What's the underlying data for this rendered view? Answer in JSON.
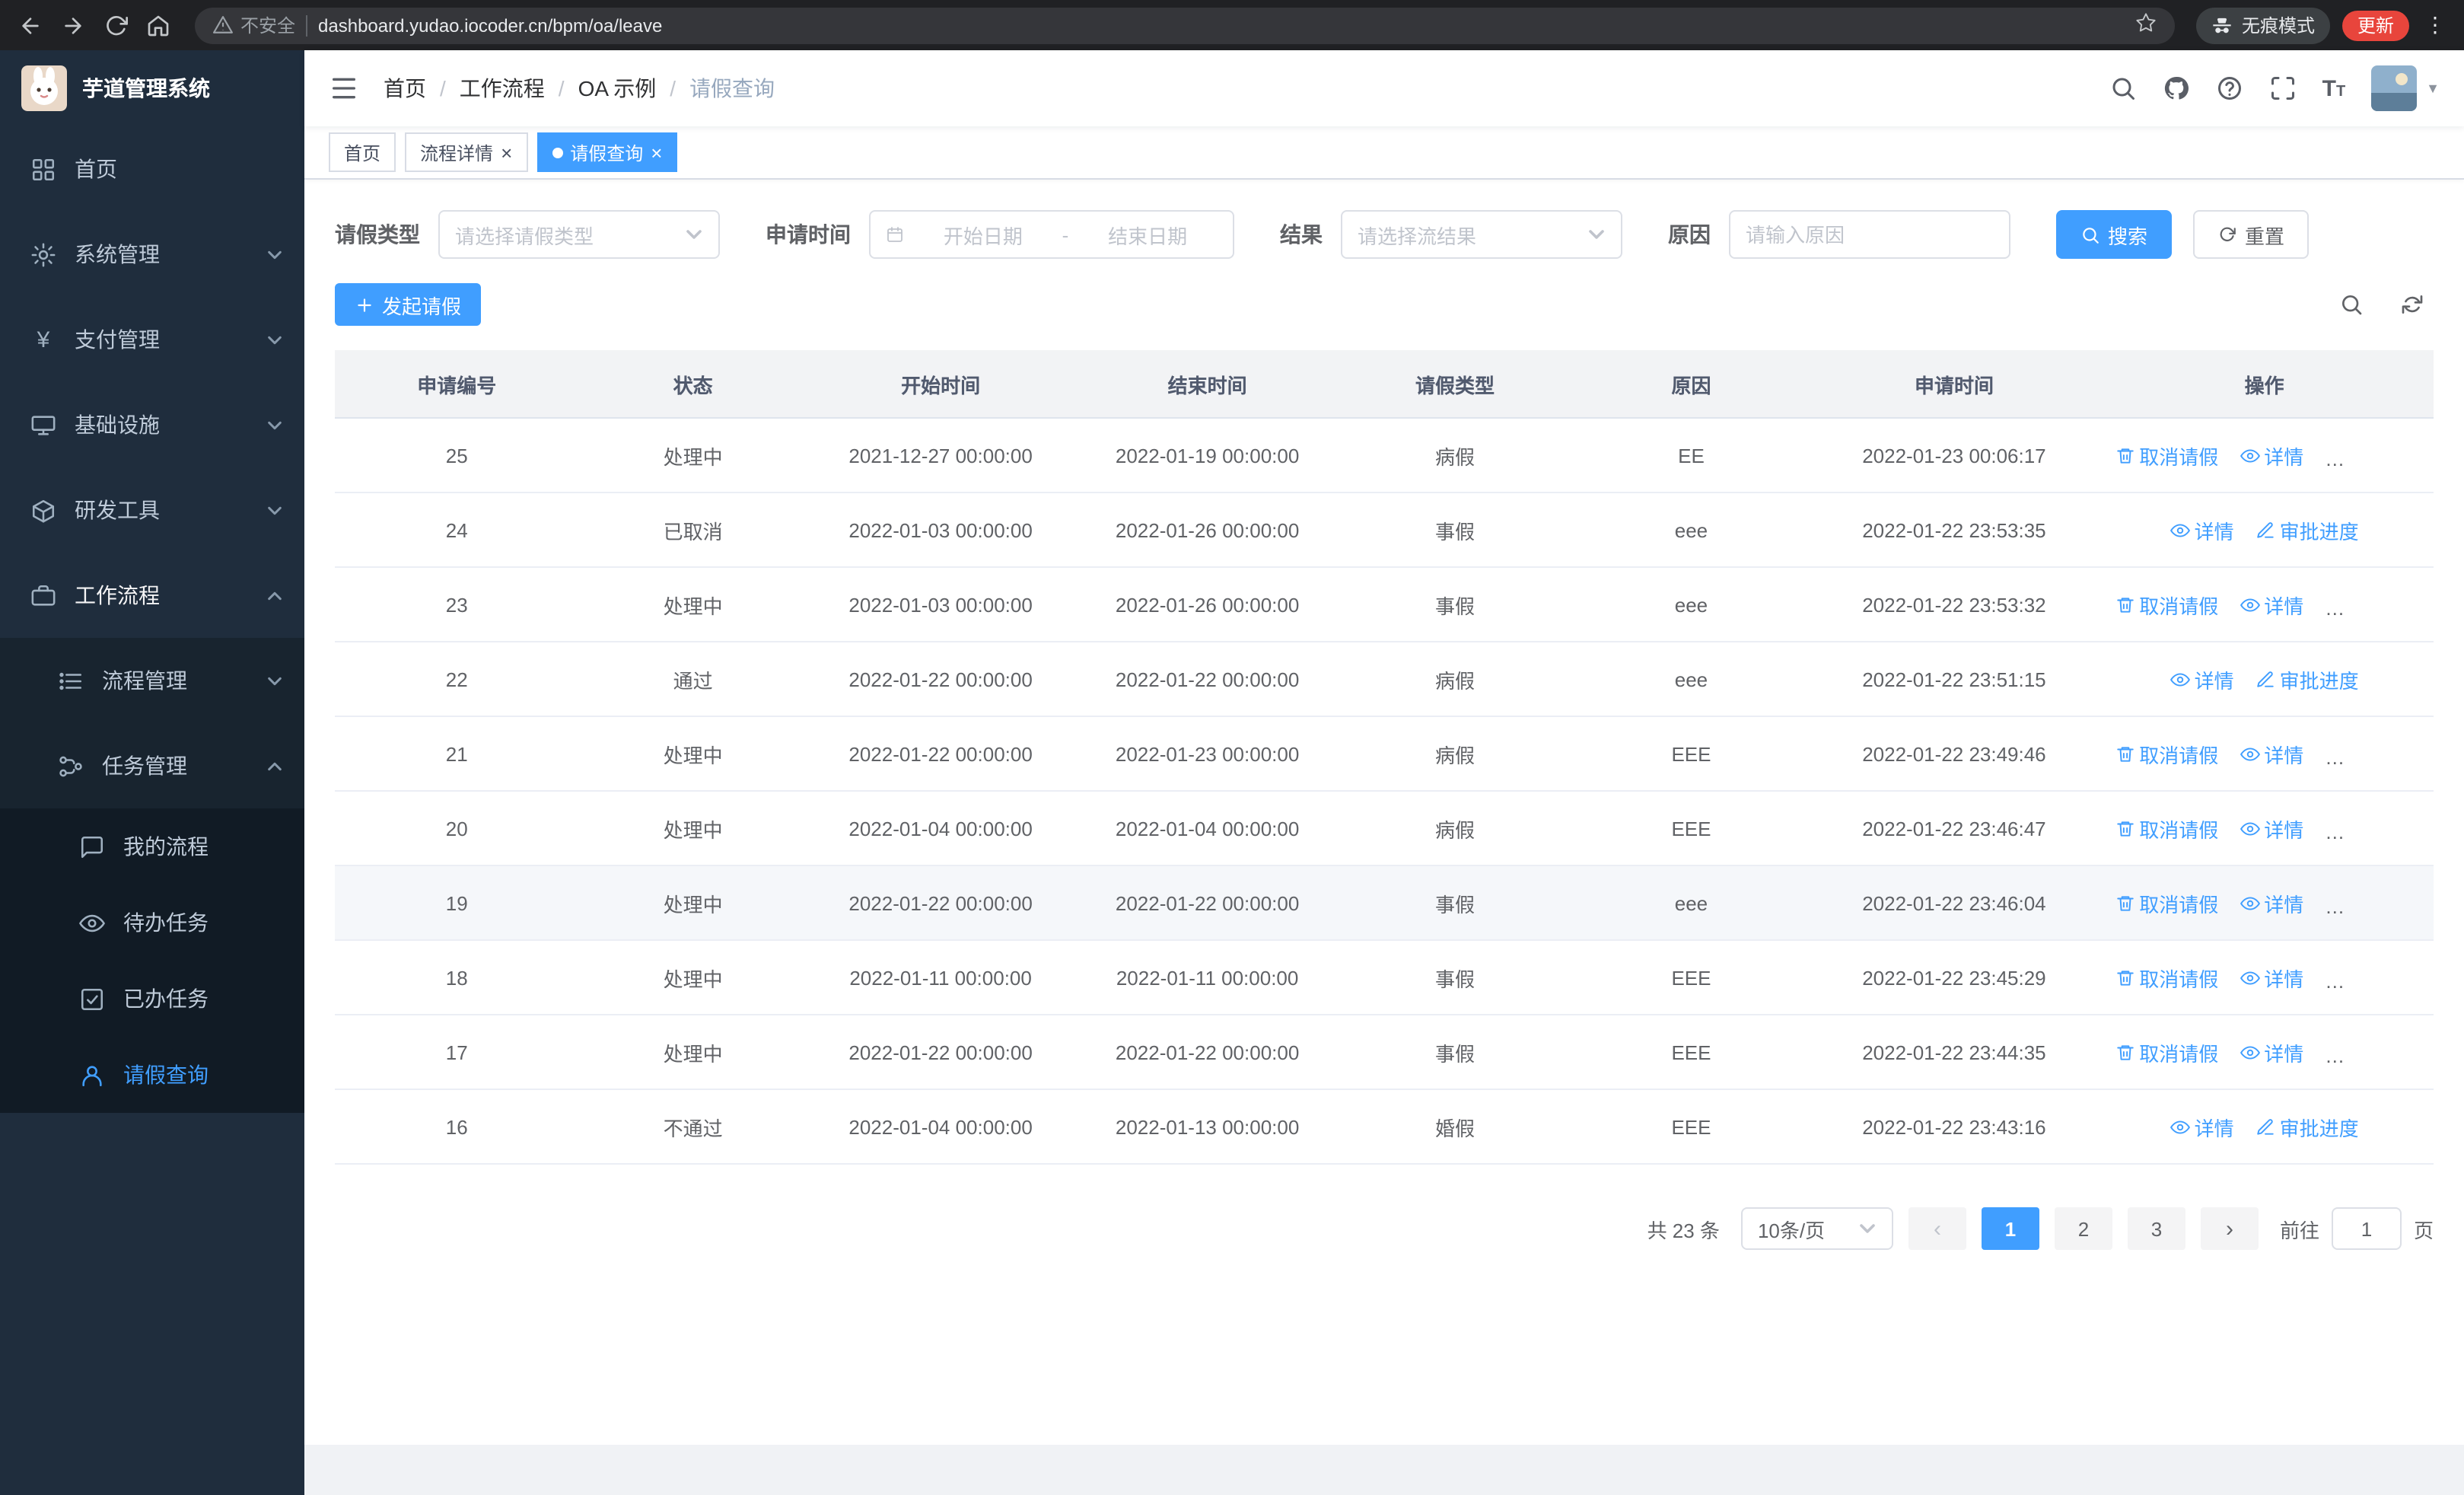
{
  "browser": {
    "security_label": "不安全",
    "url": "dashboard.yudao.iocoder.cn/bpm/oa/leave",
    "incognito_label": "无痕模式",
    "update_label": "更新"
  },
  "app": {
    "title": "芋道管理系统"
  },
  "sidebar": {
    "items": {
      "home": "首页",
      "system": "系统管理",
      "payment": "支付管理",
      "infra": "基础设施",
      "dev_tools": "研发工具",
      "workflow": "工作流程",
      "process_mgmt": "流程管理",
      "task_mgmt": "任务管理",
      "my_process": "我的流程",
      "todo_tasks": "待办任务",
      "done_tasks": "已办任务",
      "leave_query": "请假查询"
    }
  },
  "breadcrumb": {
    "items": [
      "首页",
      "工作流程",
      "OA 示例",
      "请假查询"
    ]
  },
  "tabs": [
    {
      "label": "首页"
    },
    {
      "label": "流程详情"
    },
    {
      "label": "请假查询"
    }
  ],
  "filters": {
    "leave_type_label": "请假类型",
    "leave_type_placeholder": "请选择请假类型",
    "apply_time_label": "申请时间",
    "start_date_placeholder": "开始日期",
    "range_separator": "-",
    "end_date_placeholder": "结束日期",
    "result_label": "结果",
    "result_placeholder": "请选择流结果",
    "reason_label": "原因",
    "reason_placeholder": "请输入原因",
    "search_label": "搜索",
    "reset_label": "重置"
  },
  "toolbar": {
    "create_label": "发起请假"
  },
  "table": {
    "columns": [
      "申请编号",
      "状态",
      "开始时间",
      "结束时间",
      "请假类型",
      "原因",
      "申请时间",
      "操作"
    ],
    "action_defs": {
      "cancel": {
        "label": "取消请假",
        "icon": "trash-icon"
      },
      "detail": {
        "label": "详情",
        "icon": "eye-icon"
      },
      "progress": {
        "label": "审批进度",
        "icon": "edit-icon"
      }
    },
    "rows": [
      {
        "id": "25",
        "status": "处理中",
        "start_time": "2021-12-27 00:00:00",
        "end_time": "2022-01-19 00:00:00",
        "leave_type": "病假",
        "reason": "EE",
        "apply_time": "2022-01-23 00:06:17",
        "actions": [
          "cancel",
          "detail",
          "progress"
        ],
        "highlighted": false
      },
      {
        "id": "24",
        "status": "已取消",
        "start_time": "2022-01-03 00:00:00",
        "end_time": "2022-01-26 00:00:00",
        "leave_type": "事假",
        "reason": "eee",
        "apply_time": "2022-01-22 23:53:35",
        "actions": [
          "detail",
          "progress"
        ],
        "highlighted": false
      },
      {
        "id": "23",
        "status": "处理中",
        "start_time": "2022-01-03 00:00:00",
        "end_time": "2022-01-26 00:00:00",
        "leave_type": "事假",
        "reason": "eee",
        "apply_time": "2022-01-22 23:53:32",
        "actions": [
          "cancel",
          "detail",
          "progress"
        ],
        "highlighted": false
      },
      {
        "id": "22",
        "status": "通过",
        "start_time": "2022-01-22 00:00:00",
        "end_time": "2022-01-22 00:00:00",
        "leave_type": "病假",
        "reason": "eee",
        "apply_time": "2022-01-22 23:51:15",
        "actions": [
          "detail",
          "progress"
        ],
        "highlighted": false
      },
      {
        "id": "21",
        "status": "处理中",
        "start_time": "2022-01-22 00:00:00",
        "end_time": "2022-01-23 00:00:00",
        "leave_type": "病假",
        "reason": "EEE",
        "apply_time": "2022-01-22 23:49:46",
        "actions": [
          "cancel",
          "detail",
          "progress"
        ],
        "highlighted": false
      },
      {
        "id": "20",
        "status": "处理中",
        "start_time": "2022-01-04 00:00:00",
        "end_time": "2022-01-04 00:00:00",
        "leave_type": "病假",
        "reason": "EEE",
        "apply_time": "2022-01-22 23:46:47",
        "actions": [
          "cancel",
          "detail",
          "progress"
        ],
        "highlighted": false
      },
      {
        "id": "19",
        "status": "处理中",
        "start_time": "2022-01-22 00:00:00",
        "end_time": "2022-01-22 00:00:00",
        "leave_type": "事假",
        "reason": "eee",
        "apply_time": "2022-01-22 23:46:04",
        "actions": [
          "cancel",
          "detail",
          "progress"
        ],
        "highlighted": true
      },
      {
        "id": "18",
        "status": "处理中",
        "start_time": "2022-01-11 00:00:00",
        "end_time": "2022-01-11 00:00:00",
        "leave_type": "事假",
        "reason": "EEE",
        "apply_time": "2022-01-22 23:45:29",
        "actions": [
          "cancel",
          "detail",
          "progress"
        ],
        "highlighted": false
      },
      {
        "id": "17",
        "status": "处理中",
        "start_time": "2022-01-22 00:00:00",
        "end_time": "2022-01-22 00:00:00",
        "leave_type": "事假",
        "reason": "EEE",
        "apply_time": "2022-01-22 23:44:35",
        "actions": [
          "cancel",
          "detail",
          "progress"
        ],
        "highlighted": false
      },
      {
        "id": "16",
        "status": "不通过",
        "start_time": "2022-01-04 00:00:00",
        "end_time": "2022-01-13 00:00:00",
        "leave_type": "婚假",
        "reason": "EEE",
        "apply_time": "2022-01-22 23:43:16",
        "actions": [
          "detail",
          "progress"
        ],
        "highlighted": false
      }
    ]
  },
  "pagination": {
    "total_label": "共 23 条",
    "page_size": "10条/页",
    "pages": [
      "1",
      "2",
      "3"
    ],
    "active_page": "1",
    "prev_icon": "chevron-left-icon",
    "next_icon": "chevron-right-icon",
    "goto_label": "前往",
    "goto_value": "1",
    "page_unit": "页"
  },
  "colors": {
    "primary": "#409eff",
    "sidebar_bg": "#1f2d3d",
    "chrome_bg": "#202124",
    "update_chip": "#e8453c",
    "row_hover": "#f5f7fa"
  }
}
